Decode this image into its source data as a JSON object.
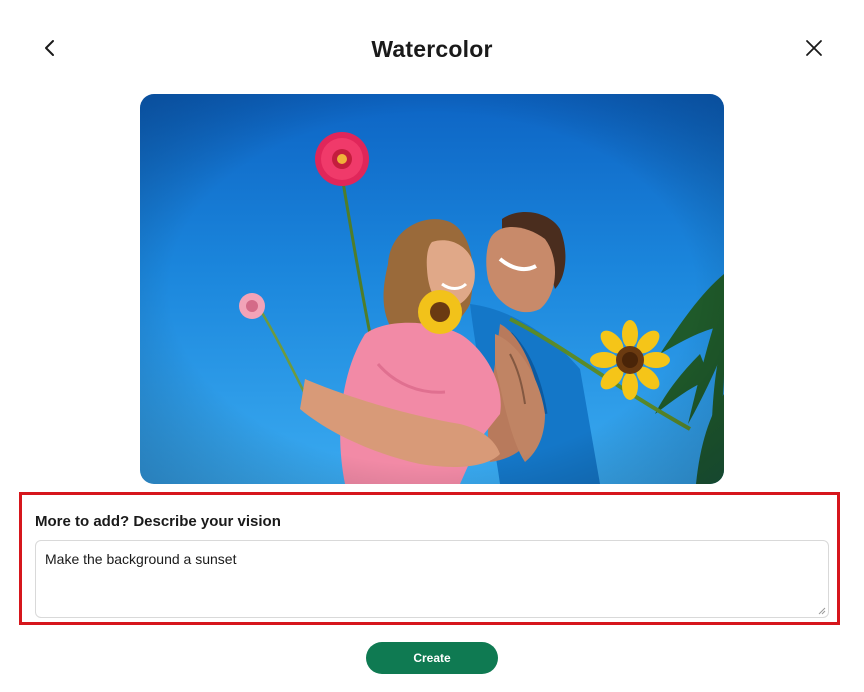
{
  "dialog": {
    "title": "Watercolor",
    "back_icon": "chevron-left-icon",
    "close_icon": "close-icon"
  },
  "image": {
    "icon": "photo-preview",
    "subject": "couple-with-flowers"
  },
  "prompt": {
    "label": "More to add? Describe your vision",
    "value": "Make the background a sunset"
  },
  "actions": {
    "create_label": "Create"
  },
  "colors": {
    "accent": "#0f7a52",
    "highlight_border": "#d6161c",
    "sky": "#1f8fe0"
  }
}
